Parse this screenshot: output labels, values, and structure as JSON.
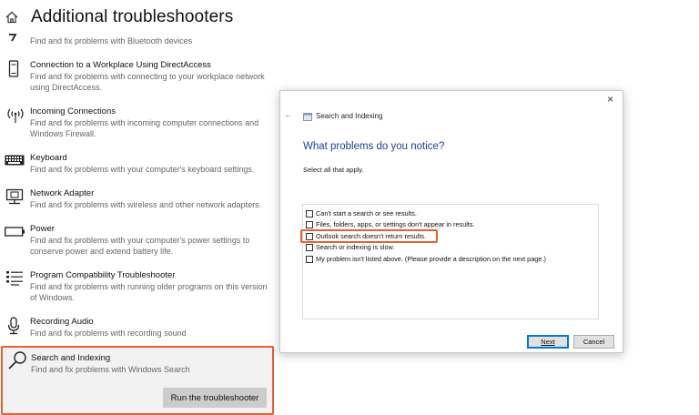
{
  "settings": {
    "title": "Additional troubleshooters",
    "items": [
      {
        "title": "",
        "desc": "Find and fix problems with Bluetooth devices"
      },
      {
        "title": "Connection to a Workplace Using DirectAccess",
        "desc": "Find and fix problems with connecting to your workplace network using DirectAccess."
      },
      {
        "title": "Incoming Connections",
        "desc": "Find and fix problems with incoming computer connections and Windows Firewall."
      },
      {
        "title": "Keyboard",
        "desc": "Find and fix problems with your computer's keyboard settings."
      },
      {
        "title": "Network Adapter",
        "desc": "Find and fix problems with wireless and other network adapters."
      },
      {
        "title": "Power",
        "desc": "Find and fix problems with your computer's power settings to conserve power and extend battery life."
      },
      {
        "title": "Program Compatibility Troubleshooter",
        "desc": "Find and fix problems with running older programs on this version of Windows."
      },
      {
        "title": "Recording Audio",
        "desc": "Find and fix problems with recording sound"
      }
    ],
    "selected": {
      "title": "Search and Indexing",
      "desc": "Find and fix problems with Windows Search",
      "button": "Run the troubleshooter"
    },
    "icons": [
      "home-icon",
      "bluetooth-icon",
      "phone-directaccess-icon",
      "antenna-icon",
      "keyboard-icon",
      "network-monitor-icon",
      "battery-icon",
      "list-icon",
      "microphone-icon",
      "search-icon"
    ]
  },
  "dialog": {
    "close": "×",
    "back": "←",
    "app_title": "Search and Indexing",
    "heading": "What problems do you notice?",
    "instruction": "Select all that apply.",
    "options": [
      "Can't start a search or see results.",
      "Files, folders, apps, or settings don't appear in results.",
      "Outlook search doesn't return results.",
      "Search or indexing is slow.",
      "My problem isn't listed above. (Please provide a description on the next page.)"
    ],
    "next_label": "Next",
    "cancel_label": "Cancel"
  },
  "colors": {
    "highlight": "#e8602f",
    "heading_blue": "#1e3f94",
    "button_grey": "#cccccc"
  }
}
